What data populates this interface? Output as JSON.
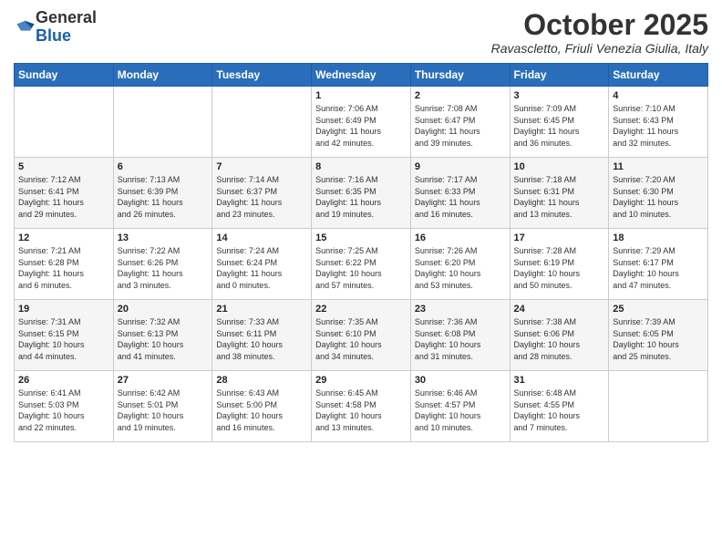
{
  "logo": {
    "general": "General",
    "blue": "Blue"
  },
  "header": {
    "month": "October 2025",
    "location": "Ravascletto, Friuli Venezia Giulia, Italy"
  },
  "weekdays": [
    "Sunday",
    "Monday",
    "Tuesday",
    "Wednesday",
    "Thursday",
    "Friday",
    "Saturday"
  ],
  "weeks": [
    [
      {
        "day": "",
        "info": ""
      },
      {
        "day": "",
        "info": ""
      },
      {
        "day": "",
        "info": ""
      },
      {
        "day": "1",
        "info": "Sunrise: 7:06 AM\nSunset: 6:49 PM\nDaylight: 11 hours\nand 42 minutes."
      },
      {
        "day": "2",
        "info": "Sunrise: 7:08 AM\nSunset: 6:47 PM\nDaylight: 11 hours\nand 39 minutes."
      },
      {
        "day": "3",
        "info": "Sunrise: 7:09 AM\nSunset: 6:45 PM\nDaylight: 11 hours\nand 36 minutes."
      },
      {
        "day": "4",
        "info": "Sunrise: 7:10 AM\nSunset: 6:43 PM\nDaylight: 11 hours\nand 32 minutes."
      }
    ],
    [
      {
        "day": "5",
        "info": "Sunrise: 7:12 AM\nSunset: 6:41 PM\nDaylight: 11 hours\nand 29 minutes."
      },
      {
        "day": "6",
        "info": "Sunrise: 7:13 AM\nSunset: 6:39 PM\nDaylight: 11 hours\nand 26 minutes."
      },
      {
        "day": "7",
        "info": "Sunrise: 7:14 AM\nSunset: 6:37 PM\nDaylight: 11 hours\nand 23 minutes."
      },
      {
        "day": "8",
        "info": "Sunrise: 7:16 AM\nSunset: 6:35 PM\nDaylight: 11 hours\nand 19 minutes."
      },
      {
        "day": "9",
        "info": "Sunrise: 7:17 AM\nSunset: 6:33 PM\nDaylight: 11 hours\nand 16 minutes."
      },
      {
        "day": "10",
        "info": "Sunrise: 7:18 AM\nSunset: 6:31 PM\nDaylight: 11 hours\nand 13 minutes."
      },
      {
        "day": "11",
        "info": "Sunrise: 7:20 AM\nSunset: 6:30 PM\nDaylight: 11 hours\nand 10 minutes."
      }
    ],
    [
      {
        "day": "12",
        "info": "Sunrise: 7:21 AM\nSunset: 6:28 PM\nDaylight: 11 hours\nand 6 minutes."
      },
      {
        "day": "13",
        "info": "Sunrise: 7:22 AM\nSunset: 6:26 PM\nDaylight: 11 hours\nand 3 minutes."
      },
      {
        "day": "14",
        "info": "Sunrise: 7:24 AM\nSunset: 6:24 PM\nDaylight: 11 hours\nand 0 minutes."
      },
      {
        "day": "15",
        "info": "Sunrise: 7:25 AM\nSunset: 6:22 PM\nDaylight: 10 hours\nand 57 minutes."
      },
      {
        "day": "16",
        "info": "Sunrise: 7:26 AM\nSunset: 6:20 PM\nDaylight: 10 hours\nand 53 minutes."
      },
      {
        "day": "17",
        "info": "Sunrise: 7:28 AM\nSunset: 6:19 PM\nDaylight: 10 hours\nand 50 minutes."
      },
      {
        "day": "18",
        "info": "Sunrise: 7:29 AM\nSunset: 6:17 PM\nDaylight: 10 hours\nand 47 minutes."
      }
    ],
    [
      {
        "day": "19",
        "info": "Sunrise: 7:31 AM\nSunset: 6:15 PM\nDaylight: 10 hours\nand 44 minutes."
      },
      {
        "day": "20",
        "info": "Sunrise: 7:32 AM\nSunset: 6:13 PM\nDaylight: 10 hours\nand 41 minutes."
      },
      {
        "day": "21",
        "info": "Sunrise: 7:33 AM\nSunset: 6:11 PM\nDaylight: 10 hours\nand 38 minutes."
      },
      {
        "day": "22",
        "info": "Sunrise: 7:35 AM\nSunset: 6:10 PM\nDaylight: 10 hours\nand 34 minutes."
      },
      {
        "day": "23",
        "info": "Sunrise: 7:36 AM\nSunset: 6:08 PM\nDaylight: 10 hours\nand 31 minutes."
      },
      {
        "day": "24",
        "info": "Sunrise: 7:38 AM\nSunset: 6:06 PM\nDaylight: 10 hours\nand 28 minutes."
      },
      {
        "day": "25",
        "info": "Sunrise: 7:39 AM\nSunset: 6:05 PM\nDaylight: 10 hours\nand 25 minutes."
      }
    ],
    [
      {
        "day": "26",
        "info": "Sunrise: 6:41 AM\nSunset: 5:03 PM\nDaylight: 10 hours\nand 22 minutes."
      },
      {
        "day": "27",
        "info": "Sunrise: 6:42 AM\nSunset: 5:01 PM\nDaylight: 10 hours\nand 19 minutes."
      },
      {
        "day": "28",
        "info": "Sunrise: 6:43 AM\nSunset: 5:00 PM\nDaylight: 10 hours\nand 16 minutes."
      },
      {
        "day": "29",
        "info": "Sunrise: 6:45 AM\nSunset: 4:58 PM\nDaylight: 10 hours\nand 13 minutes."
      },
      {
        "day": "30",
        "info": "Sunrise: 6:46 AM\nSunset: 4:57 PM\nDaylight: 10 hours\nand 10 minutes."
      },
      {
        "day": "31",
        "info": "Sunrise: 6:48 AM\nSunset: 4:55 PM\nDaylight: 10 hours\nand 7 minutes."
      },
      {
        "day": "",
        "info": ""
      }
    ]
  ]
}
